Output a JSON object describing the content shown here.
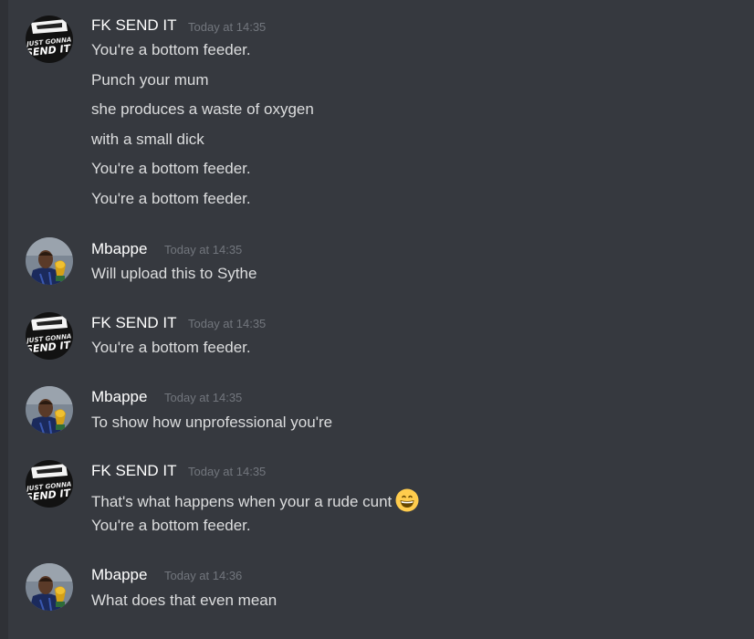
{
  "groups": [
    {
      "author": "FK SEND IT",
      "timestamp": "Today at 14:35",
      "avatar": "just-gonna-send-it-avatar",
      "messages": [
        "You're a bottom feeder.",
        "Punch your mum",
        "she produces a waste of oxygen",
        "with a small dick",
        "You're a bottom feeder.",
        "You're a bottom feeder."
      ]
    },
    {
      "author": "Mbappe",
      "timestamp": "Today at 14:35",
      "avatar": "football-player-trophy-avatar",
      "messages": [
        "Will upload this to Sythe"
      ]
    },
    {
      "author": "FK SEND IT",
      "timestamp": "Today at 14:35",
      "avatar": "just-gonna-send-it-avatar",
      "messages": [
        "You're a bottom feeder."
      ]
    },
    {
      "author": "Mbappe",
      "timestamp": "Today at 14:35",
      "avatar": "football-player-trophy-avatar",
      "messages": [
        "To show how unprofessional you're"
      ]
    },
    {
      "author": "FK SEND IT",
      "timestamp": "Today at 14:35",
      "avatar": "just-gonna-send-it-avatar",
      "messages": [
        "That's what happens when your a rude cunt",
        "You're a bottom feeder."
      ],
      "emoji": "grinning-face-emoji"
    },
    {
      "author": "Mbappe",
      "timestamp": "Today at 14:36",
      "avatar": "football-player-trophy-avatar",
      "messages": [
        "What does that even mean"
      ]
    }
  ],
  "colors": {
    "background": "#36393f",
    "username": "#ffffff",
    "message_text": "#dcddde",
    "timestamp": "#72767d"
  }
}
